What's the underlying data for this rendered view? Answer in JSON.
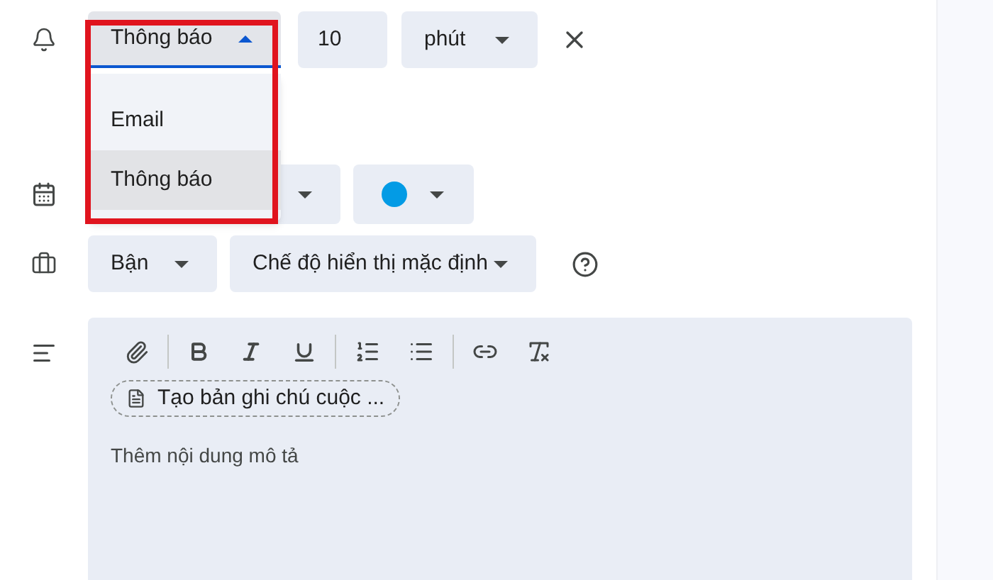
{
  "reminder": {
    "method": {
      "value": "Thông báo",
      "expanded": true,
      "options": [
        {
          "label": "Email",
          "selected": false
        },
        {
          "label": "Thông báo",
          "selected": true
        }
      ]
    },
    "amount": "10",
    "unit": "phút"
  },
  "calendar": {
    "color": "#039be5"
  },
  "availability": {
    "value": "Bận"
  },
  "visibility": {
    "value": "Chế độ hiển thị mặc định"
  },
  "description": {
    "notes_chip": "Tạo bản ghi chú cuộc ...",
    "placeholder": "Thêm nội dung mô tả"
  }
}
